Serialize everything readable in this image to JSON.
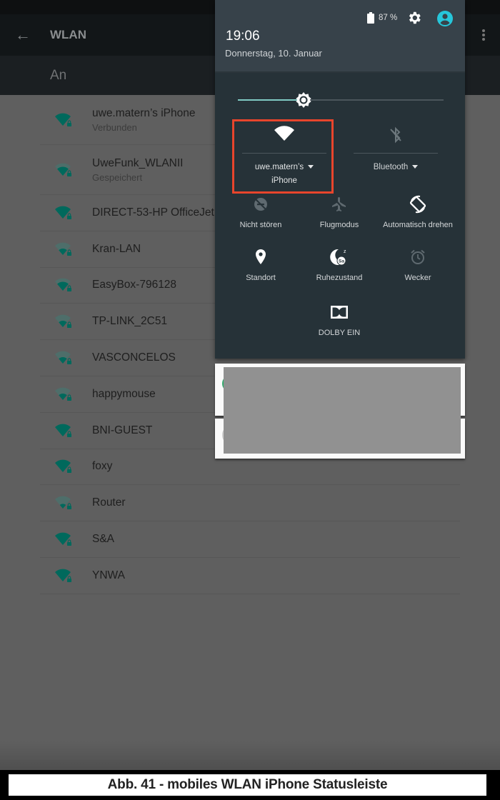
{
  "wlan_screen": {
    "title": "WLAN",
    "back_icon": "arrow-left-icon",
    "overflow_icon": "more-vert-icon",
    "switch_label": "An",
    "networks": [
      {
        "name": "uwe.matern’s iPhone",
        "status": "Verbunden",
        "signal": "full",
        "secured": true
      },
      {
        "name": "UweFunk_WLANII",
        "status": "Gespeichert",
        "signal": "medium",
        "secured": true
      },
      {
        "name": "DIRECT-53-HP OfficeJet",
        "status": "",
        "signal": "full",
        "secured": true
      },
      {
        "name": "Kran-LAN",
        "status": "",
        "signal": "low",
        "secured": true
      },
      {
        "name": "EasyBox-796128",
        "status": "",
        "signal": "medium",
        "secured": true
      },
      {
        "name": "TP-LINK_2C51",
        "status": "",
        "signal": "low",
        "secured": true
      },
      {
        "name": "VASCONCELOS",
        "status": "",
        "signal": "low",
        "secured": true
      },
      {
        "name": "happymouse",
        "status": "",
        "signal": "low",
        "secured": true
      },
      {
        "name": "BNI-GUEST",
        "status": "",
        "signal": "full",
        "secured": true
      },
      {
        "name": "foxy",
        "status": "",
        "signal": "full",
        "secured": true
      },
      {
        "name": "Router",
        "status": "",
        "signal": "weak",
        "secured": true
      },
      {
        "name": "S&A",
        "status": "",
        "signal": "full",
        "secured": true
      },
      {
        "name": "YNWA",
        "status": "",
        "signal": "full",
        "secured": true
      }
    ]
  },
  "quick_settings": {
    "battery_text": "87 %",
    "battery_icon": "battery-icon",
    "settings_icon": "gear-icon",
    "user_icon": "account-circle-icon",
    "time": "19:06",
    "date": "Donnerstag, 10. Januar",
    "brightness_level": 0.32,
    "wifi_tile": {
      "label_line1": "uwe.matern’s",
      "label_line2": "iPhone",
      "icon": "wifi-icon",
      "active": true
    },
    "bluetooth_tile": {
      "label": "Bluetooth",
      "icon": "bluetooth-off-icon",
      "active": false
    },
    "tiles": [
      {
        "label": "Nicht stören",
        "icon": "do-not-disturb-icon",
        "active": false
      },
      {
        "label": "Flugmodus",
        "icon": "airplane-icon",
        "active": false
      },
      {
        "label": "Automatisch drehen",
        "icon": "auto-rotate-icon",
        "active": true
      },
      {
        "label": "Standort",
        "icon": "location-icon",
        "active": true
      },
      {
        "label": "Ruhezustand",
        "icon": "sleep-mode-icon",
        "active": true
      },
      {
        "label": "Wecker",
        "icon": "alarm-icon",
        "active": false
      },
      {
        "label": "DOLBY EIN",
        "icon": "dolby-icon",
        "active": true
      }
    ]
  },
  "colors": {
    "highlight": "#e8452c",
    "accent": "#80cbc4",
    "wifi_green": "#00695c",
    "user_icon": "#26c6da"
  },
  "caption": "Abb. 41 - mobiles WLAN iPhone Statusleiste"
}
